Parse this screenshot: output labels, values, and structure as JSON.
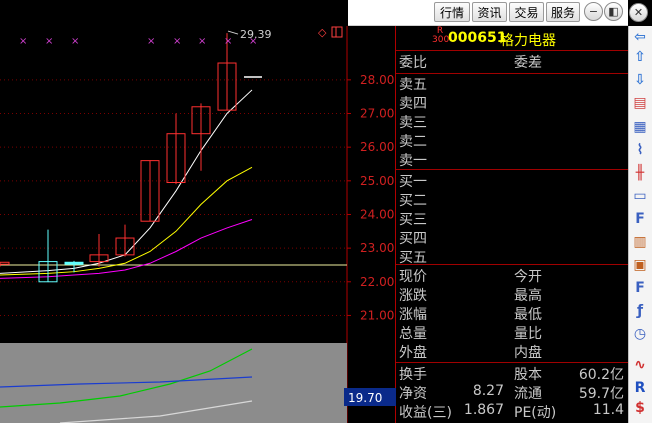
{
  "toolbar": {
    "buttons": [
      "行情",
      "资讯",
      "交易",
      "服务"
    ],
    "window_icons": [
      "minimize-icon",
      "restore-icon",
      "close-icon"
    ]
  },
  "stock": {
    "badge_top": "R",
    "badge_bottom": "300",
    "code": "000651",
    "name": "格力电器"
  },
  "quote": {
    "weibi_label": "委比",
    "weicha_label": "委差",
    "sell_levels": [
      "卖五",
      "卖四",
      "卖三",
      "卖二",
      "卖一"
    ],
    "buy_levels": [
      "买一",
      "买二",
      "买三",
      "买四",
      "买五"
    ],
    "stats_left": [
      "现价",
      "涨跌",
      "涨幅",
      "总量",
      "外盘"
    ],
    "stats_right": [
      "今开",
      "最高",
      "最低",
      "量比",
      "内盘"
    ],
    "bottom": [
      {
        "l1": "换手",
        "v1": "",
        "l2": "股本",
        "v2": "60.2亿"
      },
      {
        "l1": "净资",
        "v1": "8.27",
        "l2": "流通",
        "v2": "59.7亿"
      },
      {
        "l1": "收益(三)",
        "v1": "1.867",
        "l2": "PE(动)",
        "v2": "11.4"
      }
    ]
  },
  "chart_data": {
    "type": "candlestick",
    "price_axis": [
      "28.00",
      "27.00",
      "26.00",
      "25.00",
      "24.00",
      "23.00",
      "22.00",
      "21.00"
    ],
    "price_ylim": [
      20.3,
      29.6
    ],
    "current_price_tag": "19.70",
    "high_annotation": "29.39",
    "candles": [
      {
        "o": 22.55,
        "h": 22.58,
        "l": 22.45,
        "c": 22.58
      },
      {
        "o": 22.6,
        "h": 23.55,
        "l": 22.0,
        "c": 22.0
      },
      {
        "o": 22.58,
        "h": 22.62,
        "l": 22.28,
        "c": 22.58
      },
      {
        "o": 22.6,
        "h": 23.42,
        "l": 22.45,
        "c": 22.8
      },
      {
        "o": 22.8,
        "h": 23.7,
        "l": 22.75,
        "c": 23.3
      },
      {
        "o": 23.8,
        "h": 25.6,
        "l": 23.8,
        "c": 25.6
      },
      {
        "o": 24.95,
        "h": 27.0,
        "l": 24.9,
        "c": 26.4
      },
      {
        "o": 26.4,
        "h": 27.3,
        "l": 25.3,
        "c": 27.2
      },
      {
        "o": 27.1,
        "h": 29.39,
        "l": 27.1,
        "c": 28.5
      }
    ],
    "ma_series": [
      {
        "color": "#ffffff",
        "values": [
          22.25,
          22.33,
          22.4,
          22.55,
          22.8,
          23.6,
          24.7,
          25.9,
          27.0
        ]
      },
      {
        "color": "#ffff00",
        "values": [
          22.2,
          22.25,
          22.3,
          22.4,
          22.55,
          22.9,
          23.5,
          24.3,
          25.0
        ]
      },
      {
        "color": "#ff00ff",
        "values": [
          22.1,
          22.15,
          22.2,
          22.25,
          22.35,
          22.55,
          22.9,
          23.3,
          23.6
        ]
      }
    ],
    "flat_line_value": 22.5
  }
}
